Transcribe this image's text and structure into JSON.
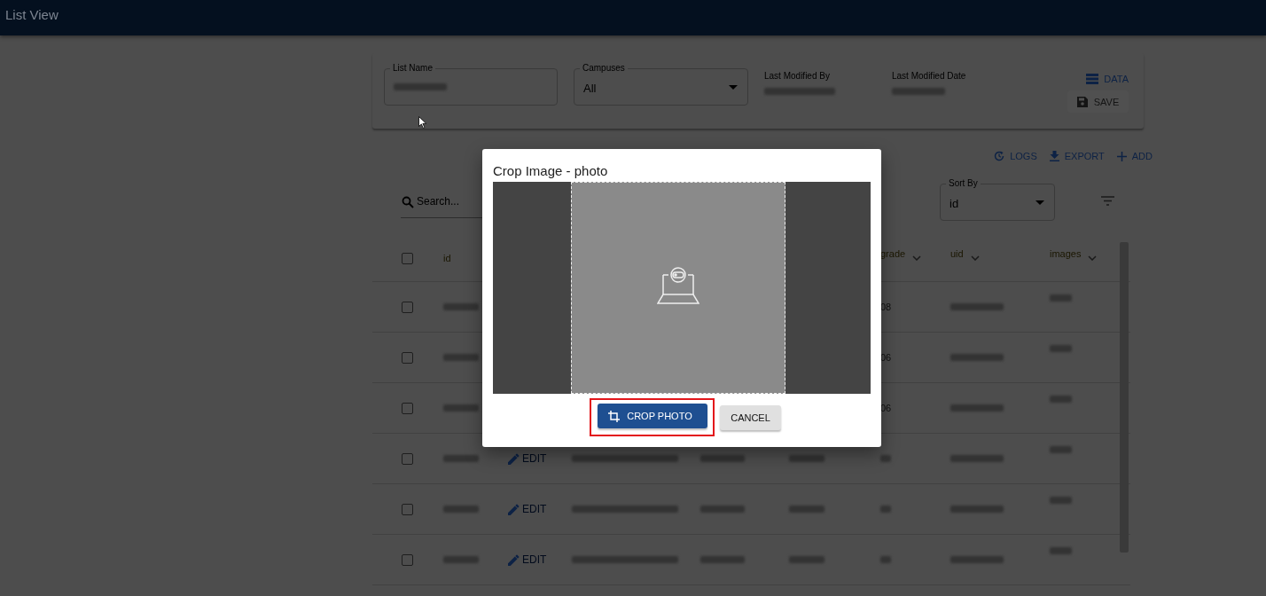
{
  "app_bar": {
    "title": "List View"
  },
  "list_form": {
    "list_name": {
      "label": "List Name"
    },
    "campuses": {
      "label": "Campuses",
      "value": "All"
    },
    "last_modified_by": {
      "label": "Last Modified By"
    },
    "last_modified_date": {
      "label": "Last Modified Date"
    },
    "data_button": "DATA",
    "save_button": {
      "label": "SAVE",
      "disabled": true
    }
  },
  "toolbar": [
    {
      "label": "LOGS",
      "kind": "logs"
    },
    {
      "label": "EXPORT",
      "kind": "export"
    },
    {
      "label": "ADD",
      "kind": "add"
    }
  ],
  "search": {
    "placeholder": "Search..."
  },
  "sort_by": {
    "label": "Sort By",
    "value": "id"
  },
  "table": {
    "select_all": {
      "checked": false
    },
    "columns": [
      {
        "label": "id"
      },
      {
        "label": "grade"
      },
      {
        "label": "uid"
      },
      {
        "label": "images"
      }
    ],
    "rows": [
      {
        "checked": false,
        "grade": "08"
      },
      {
        "checked": false,
        "grade": "06"
      },
      {
        "checked": false,
        "grade": "06"
      },
      {
        "checked": false,
        "edit": "EDIT"
      },
      {
        "checked": false,
        "edit": "EDIT"
      },
      {
        "checked": false,
        "edit": "EDIT"
      }
    ]
  },
  "dialog": {
    "title": "Crop Image - photo",
    "buttons": [
      {
        "label": "CROP PHOTO",
        "kind": "primary",
        "highlighted": true
      },
      {
        "label": "CANCEL",
        "kind": "secondary",
        "highlighted": false
      }
    ]
  }
}
